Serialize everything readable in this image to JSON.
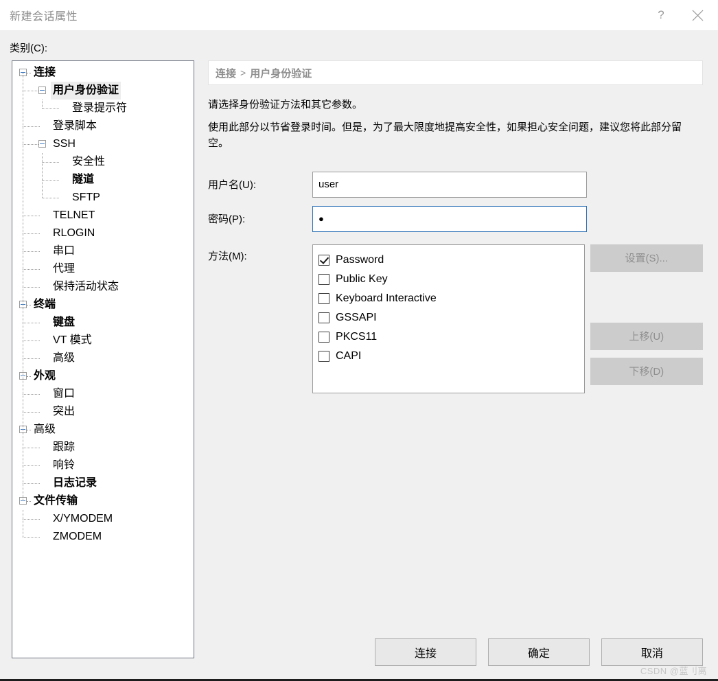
{
  "window": {
    "title": "新建会话属性",
    "help_button": "?",
    "close_button": "close-icon"
  },
  "left": {
    "category_label": "类别(C):",
    "tree": [
      {
        "label": "连接",
        "level": 0,
        "expander": true,
        "bold": true,
        "selected": false
      },
      {
        "label": "用户身份验证",
        "level": 1,
        "expander": true,
        "bold": true,
        "selected": true
      },
      {
        "label": "登录提示符",
        "level": 2,
        "expander": false,
        "bold": false,
        "selected": false
      },
      {
        "label": "登录脚本",
        "level": 1,
        "expander": false,
        "bold": false,
        "selected": false
      },
      {
        "label": "SSH",
        "level": 1,
        "expander": true,
        "bold": false,
        "selected": false
      },
      {
        "label": "安全性",
        "level": 2,
        "expander": false,
        "bold": false,
        "selected": false
      },
      {
        "label": "隧道",
        "level": 2,
        "expander": false,
        "bold": true,
        "selected": false
      },
      {
        "label": "SFTP",
        "level": 2,
        "expander": false,
        "bold": false,
        "selected": false
      },
      {
        "label": "TELNET",
        "level": 1,
        "expander": false,
        "bold": false,
        "selected": false
      },
      {
        "label": "RLOGIN",
        "level": 1,
        "expander": false,
        "bold": false,
        "selected": false
      },
      {
        "label": "串口",
        "level": 1,
        "expander": false,
        "bold": false,
        "selected": false
      },
      {
        "label": "代理",
        "level": 1,
        "expander": false,
        "bold": false,
        "selected": false
      },
      {
        "label": "保持活动状态",
        "level": 1,
        "expander": false,
        "bold": false,
        "selected": false
      },
      {
        "label": "终端",
        "level": 0,
        "expander": true,
        "bold": true,
        "selected": false
      },
      {
        "label": "键盘",
        "level": 1,
        "expander": false,
        "bold": true,
        "selected": false
      },
      {
        "label": "VT 模式",
        "level": 1,
        "expander": false,
        "bold": false,
        "selected": false
      },
      {
        "label": "高级",
        "level": 1,
        "expander": false,
        "bold": false,
        "selected": false
      },
      {
        "label": "外观",
        "level": 0,
        "expander": true,
        "bold": true,
        "selected": false
      },
      {
        "label": "窗口",
        "level": 1,
        "expander": false,
        "bold": false,
        "selected": false
      },
      {
        "label": "突出",
        "level": 1,
        "expander": false,
        "bold": false,
        "selected": false
      },
      {
        "label": "高级",
        "level": 0,
        "expander": true,
        "bold": false,
        "selected": false
      },
      {
        "label": "跟踪",
        "level": 1,
        "expander": false,
        "bold": false,
        "selected": false
      },
      {
        "label": "响铃",
        "level": 1,
        "expander": false,
        "bold": false,
        "selected": false
      },
      {
        "label": "日志记录",
        "level": 1,
        "expander": false,
        "bold": true,
        "selected": false
      },
      {
        "label": "文件传输",
        "level": 0,
        "expander": true,
        "bold": true,
        "selected": false
      },
      {
        "label": "X/YMODEM",
        "level": 1,
        "expander": false,
        "bold": false,
        "selected": false
      },
      {
        "label": "ZMODEM",
        "level": 1,
        "expander": false,
        "bold": false,
        "selected": false
      }
    ]
  },
  "right": {
    "breadcrumb": {
      "parent": "连接",
      "separator": ">",
      "current": "用户身份验证"
    },
    "description_1": "请选择身份验证方法和其它参数。",
    "description_2": "使用此部分以节省登录时间。但是，为了最大限度地提高安全性，如果担心安全问题，建议您将此部分留空。",
    "fields": {
      "username_label": "用户名(U):",
      "username_value": "user",
      "password_label": "密码(P):",
      "password_value": "●"
    },
    "method": {
      "label": "方法(M):",
      "items": [
        {
          "label": "Password",
          "checked": true
        },
        {
          "label": "Public Key",
          "checked": false
        },
        {
          "label": "Keyboard Interactive",
          "checked": false
        },
        {
          "label": "GSSAPI",
          "checked": false
        },
        {
          "label": "PKCS11",
          "checked": false
        },
        {
          "label": "CAPI",
          "checked": false
        }
      ]
    },
    "side_buttons": {
      "settings": "设置(S)...",
      "move_up": "上移(U)",
      "move_down": "下移(D)"
    }
  },
  "footer": {
    "connect": "连接",
    "ok": "确定",
    "cancel": "取消"
  },
  "watermark": "CSDN @蓝刂离"
}
